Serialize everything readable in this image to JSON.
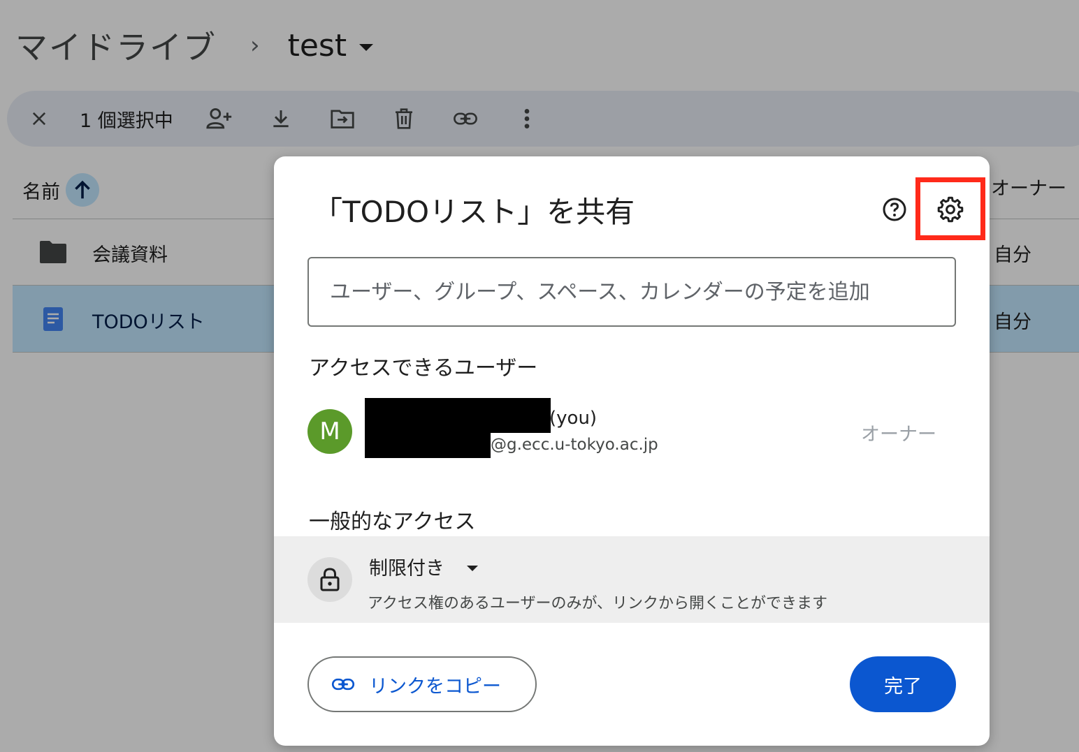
{
  "breadcrumb": {
    "root": "マイドライブ",
    "separator": "›",
    "current": "test"
  },
  "selection_bar": {
    "count_label": "1 個選択中",
    "icons": [
      "close-icon",
      "share-person-icon",
      "download-icon",
      "move-to-folder-icon",
      "trash-icon",
      "link-icon",
      "more-vert-icon"
    ]
  },
  "file_list": {
    "headers": {
      "name": "名前",
      "owner": "オーナー"
    },
    "rows": [
      {
        "name": "会議資料",
        "owner": "自分",
        "type": "folder",
        "selected": false
      },
      {
        "name": "TODOリスト",
        "owner": "自分",
        "type": "doc",
        "selected": true
      }
    ]
  },
  "dialog": {
    "title": "「TODOリスト」を共有",
    "add_input_placeholder": "ユーザー、グループ、スペース、カレンダーの予定を追加",
    "people_section_label": "アクセスできるユーザー",
    "user": {
      "avatar_letter": "M",
      "you_label": "(you)",
      "email_suffix": "@g.ecc.u-tokyo.ac.jp",
      "role": "オーナー"
    },
    "general_access_label": "一般的なアクセス",
    "access": {
      "level": "制限付き",
      "description": "アクセス権のあるユーザーのみが、リンクから開くことができます"
    },
    "copy_link_label": "リンクをコピー",
    "done_label": "完了"
  },
  "colors": {
    "accent": "#0b57d0",
    "selected_row": "#c2e7ff",
    "avatar": "#5b9a2a",
    "highlight_box": "#ff2a1a"
  }
}
